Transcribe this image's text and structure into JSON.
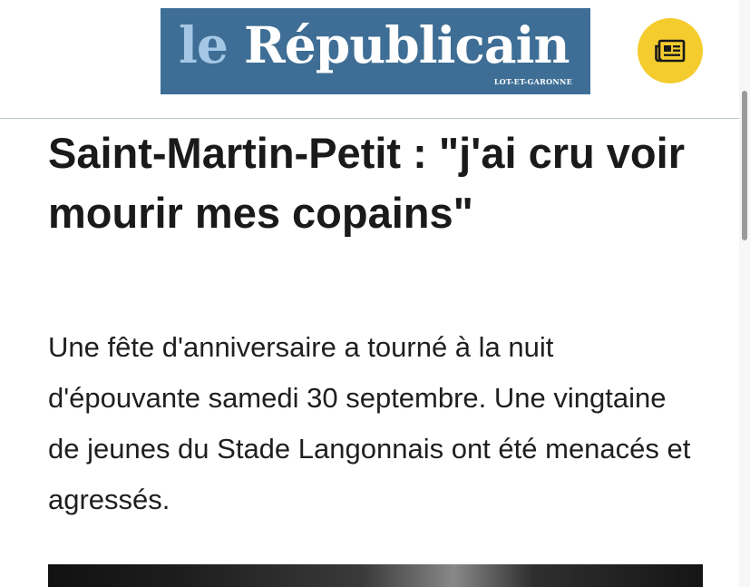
{
  "header": {
    "logo": {
      "prefix": "le",
      "name": "Républicain",
      "region": "LOT-ET-GARONNE"
    },
    "edition_button": {
      "icon": "newspaper-icon"
    }
  },
  "article": {
    "headline": "Saint-Martin-Petit : \"j'ai cru voir mourir mes copains\"",
    "lead": "Une fête d'anniversaire a tourné à la nuit d'épouvante samedi 30 septembre. Une vingtaine de jeunes du Stade Langonnais ont été menacés et agressés."
  },
  "colors": {
    "logo_background": "#3e6e95",
    "logo_prefix": "#a5c7e6",
    "edition_button": "#f5cc2e",
    "text": "#1a1a1a"
  }
}
